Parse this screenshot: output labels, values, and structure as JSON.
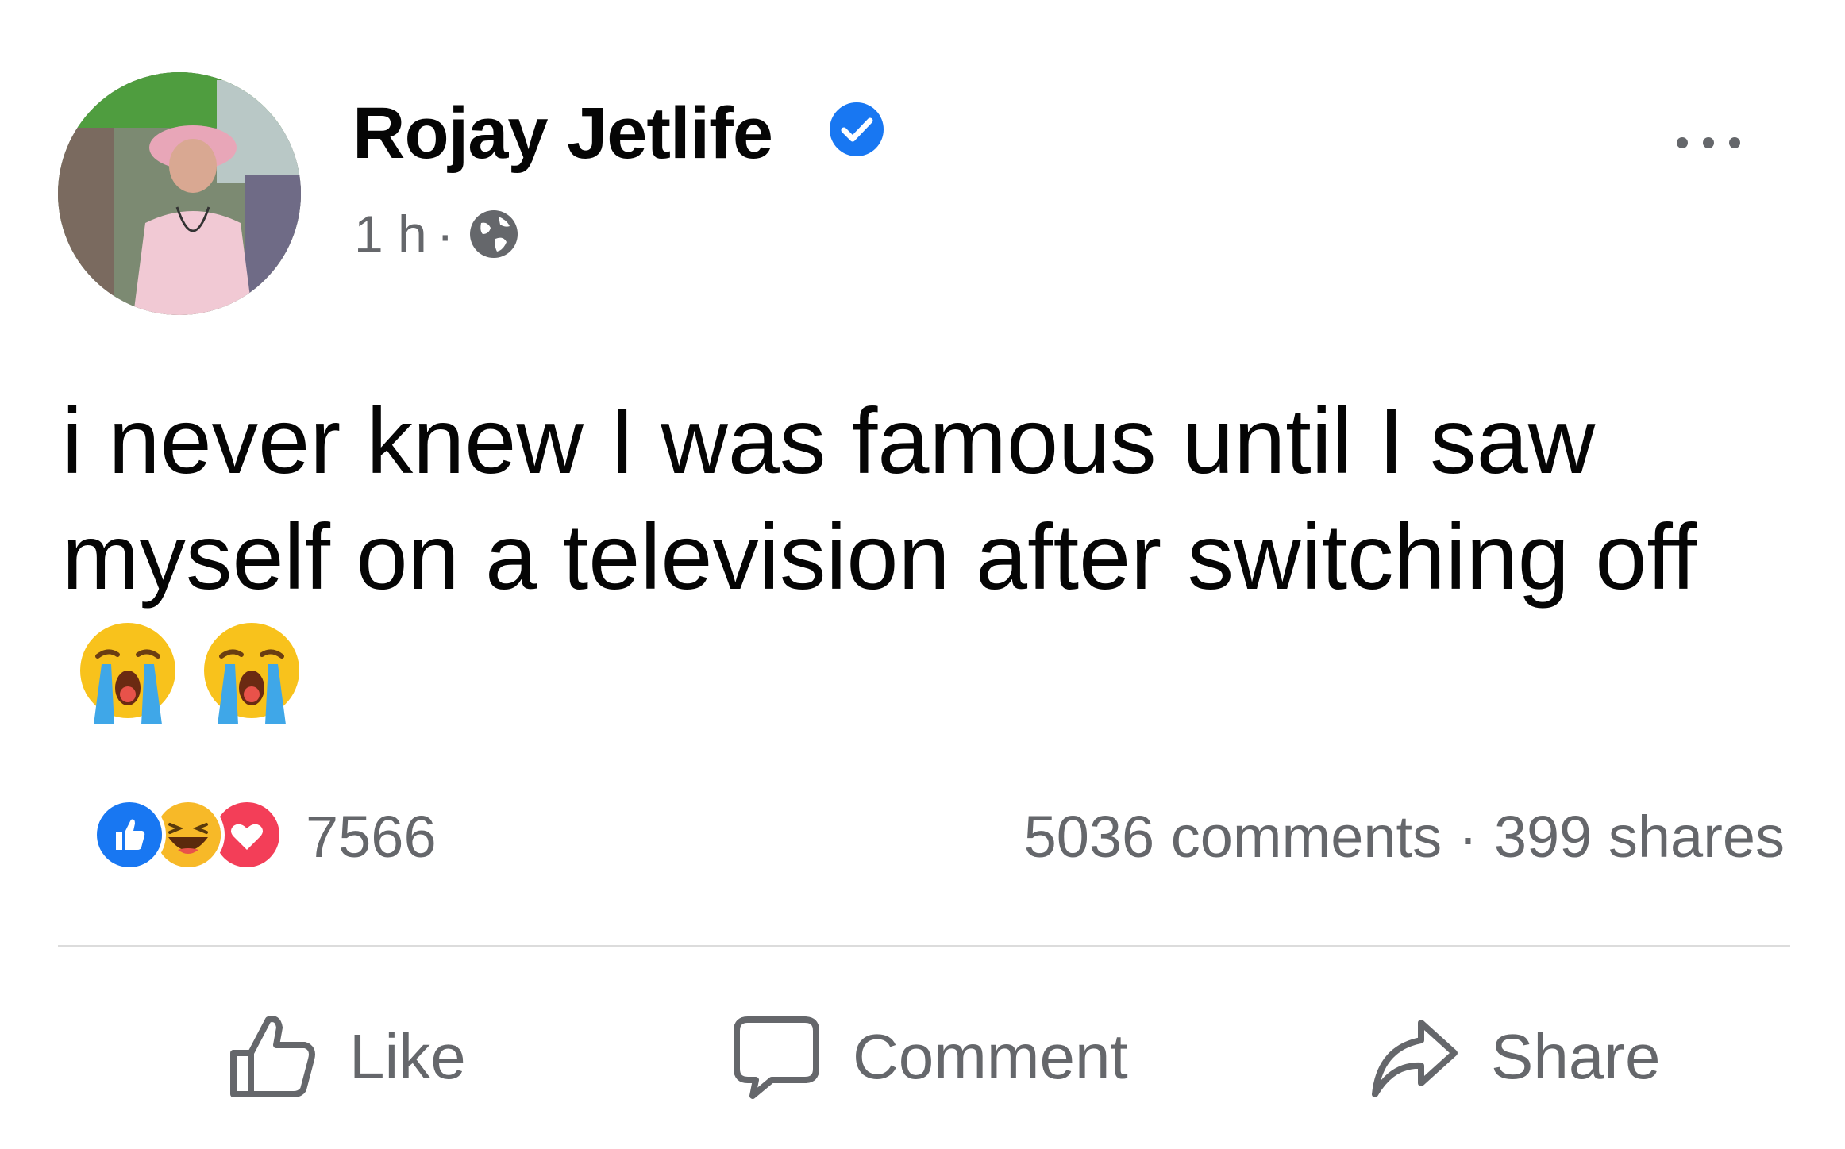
{
  "post": {
    "author": "Rojay Jetlife",
    "verified": true,
    "time": "1 h",
    "separator": "·",
    "audience_icon": "globe-icon",
    "text": "i never knew I was famous until I saw myself on a television after switching off",
    "emojis": [
      "loudly-crying-face",
      "loudly-crying-face"
    ]
  },
  "stats": {
    "reactions": [
      "like",
      "haha",
      "love"
    ],
    "reaction_count": "7566",
    "comments": "5036 comments",
    "dot": "·",
    "shares": "399 shares"
  },
  "actions": {
    "like": "Like",
    "comment": "Comment",
    "share": "Share"
  },
  "colors": {
    "text": "#050505",
    "secondary": "#65676b",
    "verified": "#1877f2",
    "like": "#1877f2",
    "love": "#f33e58",
    "haha": "#f7b928",
    "divider": "#dcdcdc"
  }
}
